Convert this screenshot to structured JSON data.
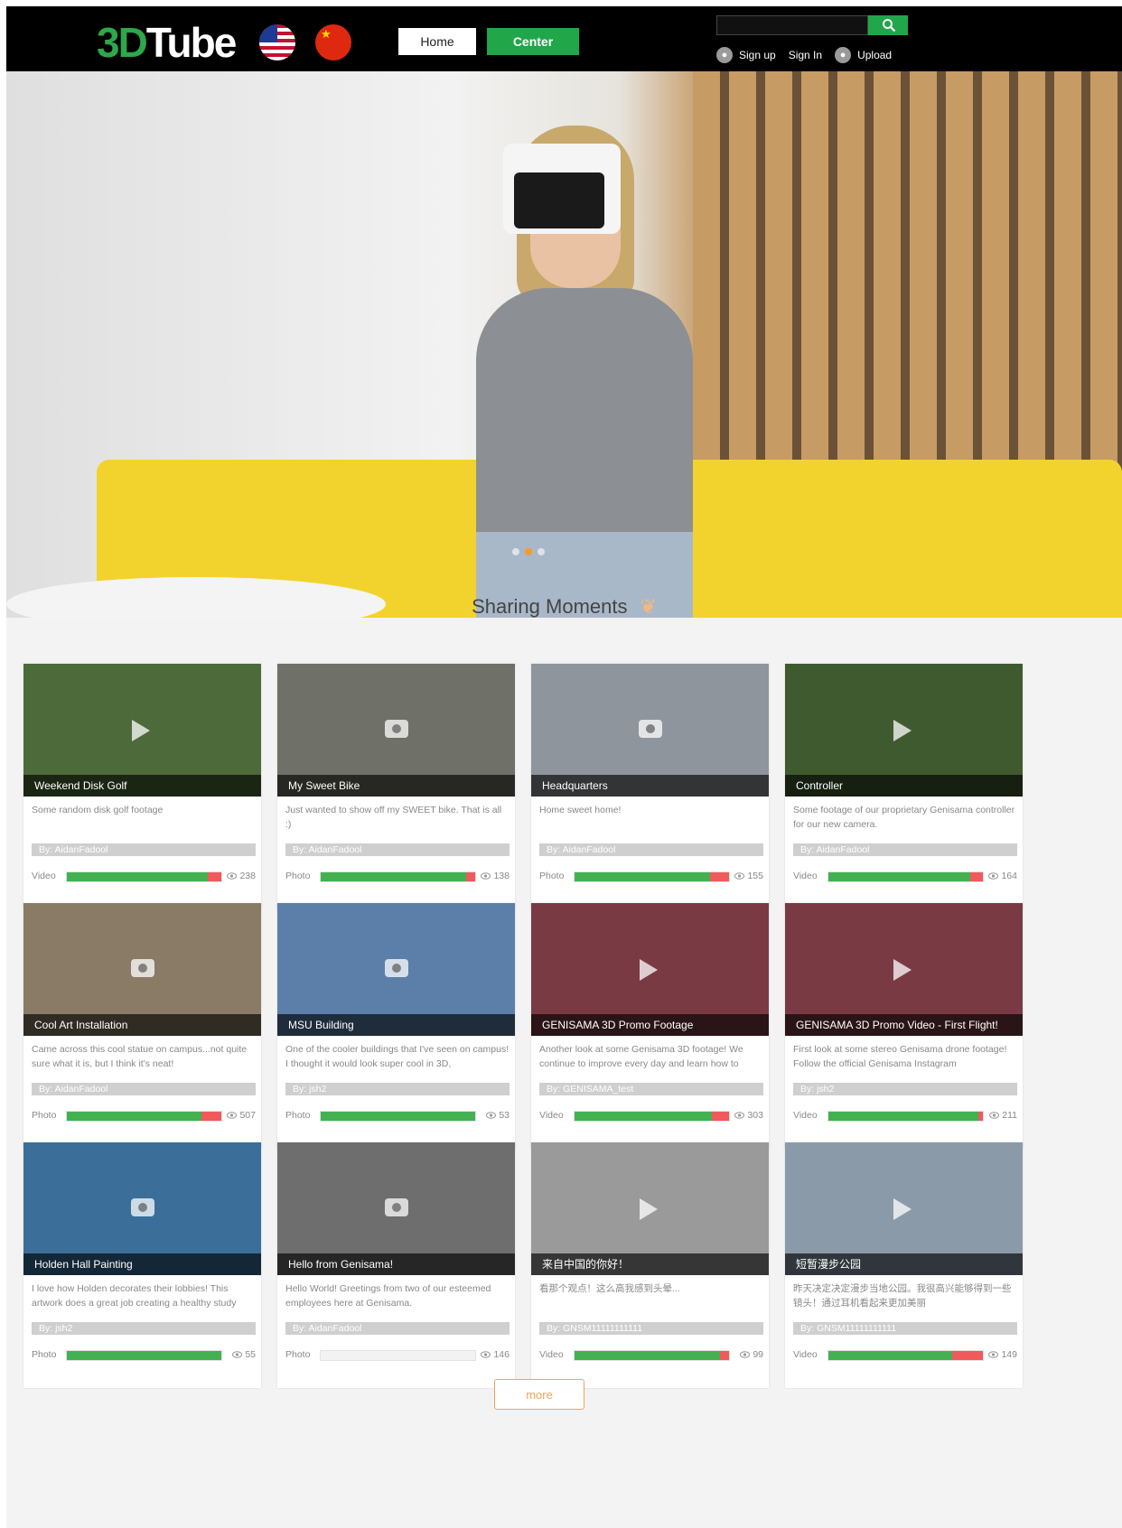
{
  "header": {
    "logo_prefix": "3D",
    "logo_suffix": "Tube",
    "home_label": "Home",
    "center_label": "Center",
    "search_placeholder": "",
    "signup_label": "Sign up",
    "signin_label": "Sign In",
    "upload_label": "Upload"
  },
  "section": {
    "title": "Sharing Moments"
  },
  "more_label": "more",
  "cards": [
    {
      "title": "Weekend Disk Golf",
      "desc": "Some random disk golf footage",
      "author": "By: AidanFadool",
      "type": "Video",
      "views": "238",
      "likes_ratio": 0.91,
      "bg": "#4d6a3a"
    },
    {
      "title": "My Sweet Bike",
      "desc": "Just wanted to show off my SWEET bike. That is all :)",
      "author": "By: AidanFadool",
      "type": "Photo",
      "views": "138",
      "likes_ratio": 0.94,
      "bg": "#6f7068"
    },
    {
      "title": "Headquarters",
      "desc": "Home sweet home!",
      "author": "By: AidanFadool",
      "type": "Photo",
      "views": "155",
      "likes_ratio": 0.88,
      "bg": "#8f959c"
    },
    {
      "title": "Controller",
      "desc": "Some footage of our proprietary Genisama controller for our new camera.",
      "author": "By: AidanFadool",
      "type": "Video",
      "views": "164",
      "likes_ratio": 0.92,
      "bg": "#3f5a2e"
    },
    {
      "title": "Cool Art Installation",
      "desc": "Came across this cool statue on campus...not quite sure what it is, but I think it's neat!",
      "author": "By: AidanFadool",
      "type": "Photo",
      "views": "507",
      "likes_ratio": 0.87,
      "bg": "#8a7b66"
    },
    {
      "title": "MSU Building",
      "desc": "One of the cooler buildings that I've seen on campus! I thought it would look super cool in 3D,",
      "author": "By: jsh2",
      "type": "Photo",
      "views": "53",
      "likes_ratio": 1.0,
      "bg": "#5b7fa8"
    },
    {
      "title": "GENISAMA 3D Promo Footage",
      "desc": "Another look at some Genisama 3D footage! We continue to improve every day and learn how to",
      "author": "By: GENISAMA_test",
      "type": "Video",
      "views": "303",
      "likes_ratio": 0.89,
      "bg": "#7a3a44"
    },
    {
      "title": "GENISAMA 3D Promo Video - First Flight!",
      "desc": "First look at some stereo Genisama drone footage! Follow the official Genisama Instagram",
      "author": "By: jsh2",
      "type": "Video",
      "views": "211",
      "likes_ratio": 0.97,
      "bg": "#7a3a44"
    },
    {
      "title": "Holden Hall Painting",
      "desc": "I love how Holden decorates their lobbies! This artwork does a great job creating a healthy study",
      "author": "By: jsh2",
      "type": "Photo",
      "views": "55",
      "likes_ratio": 1.0,
      "bg": "#3b6f9a"
    },
    {
      "title": "Hello from Genisama!",
      "desc": "Hello World! Greetings from two of our esteemed employees here at Genisama.",
      "author": "By: AidanFadool",
      "type": "Photo",
      "views": "146",
      "likes_ratio": 0.0,
      "bg": "#6e6e6e"
    },
    {
      "title": "来自中国的你好！",
      "desc": "看那个观点！这么高我感到头晕...",
      "author": "By: GNSM11111111111",
      "type": "Video",
      "views": "99",
      "likes_ratio": 0.94,
      "bg": "#9a9a9a"
    },
    {
      "title": "短暂漫步公园",
      "desc": "昨天决定决定漫步当地公园。我很高兴能够得到一些镜头！通过耳机看起来更加美丽",
      "author": "By: GNSM11111111111",
      "type": "Video",
      "views": "149",
      "likes_ratio": 0.8,
      "bg": "#8a9aa8"
    }
  ]
}
